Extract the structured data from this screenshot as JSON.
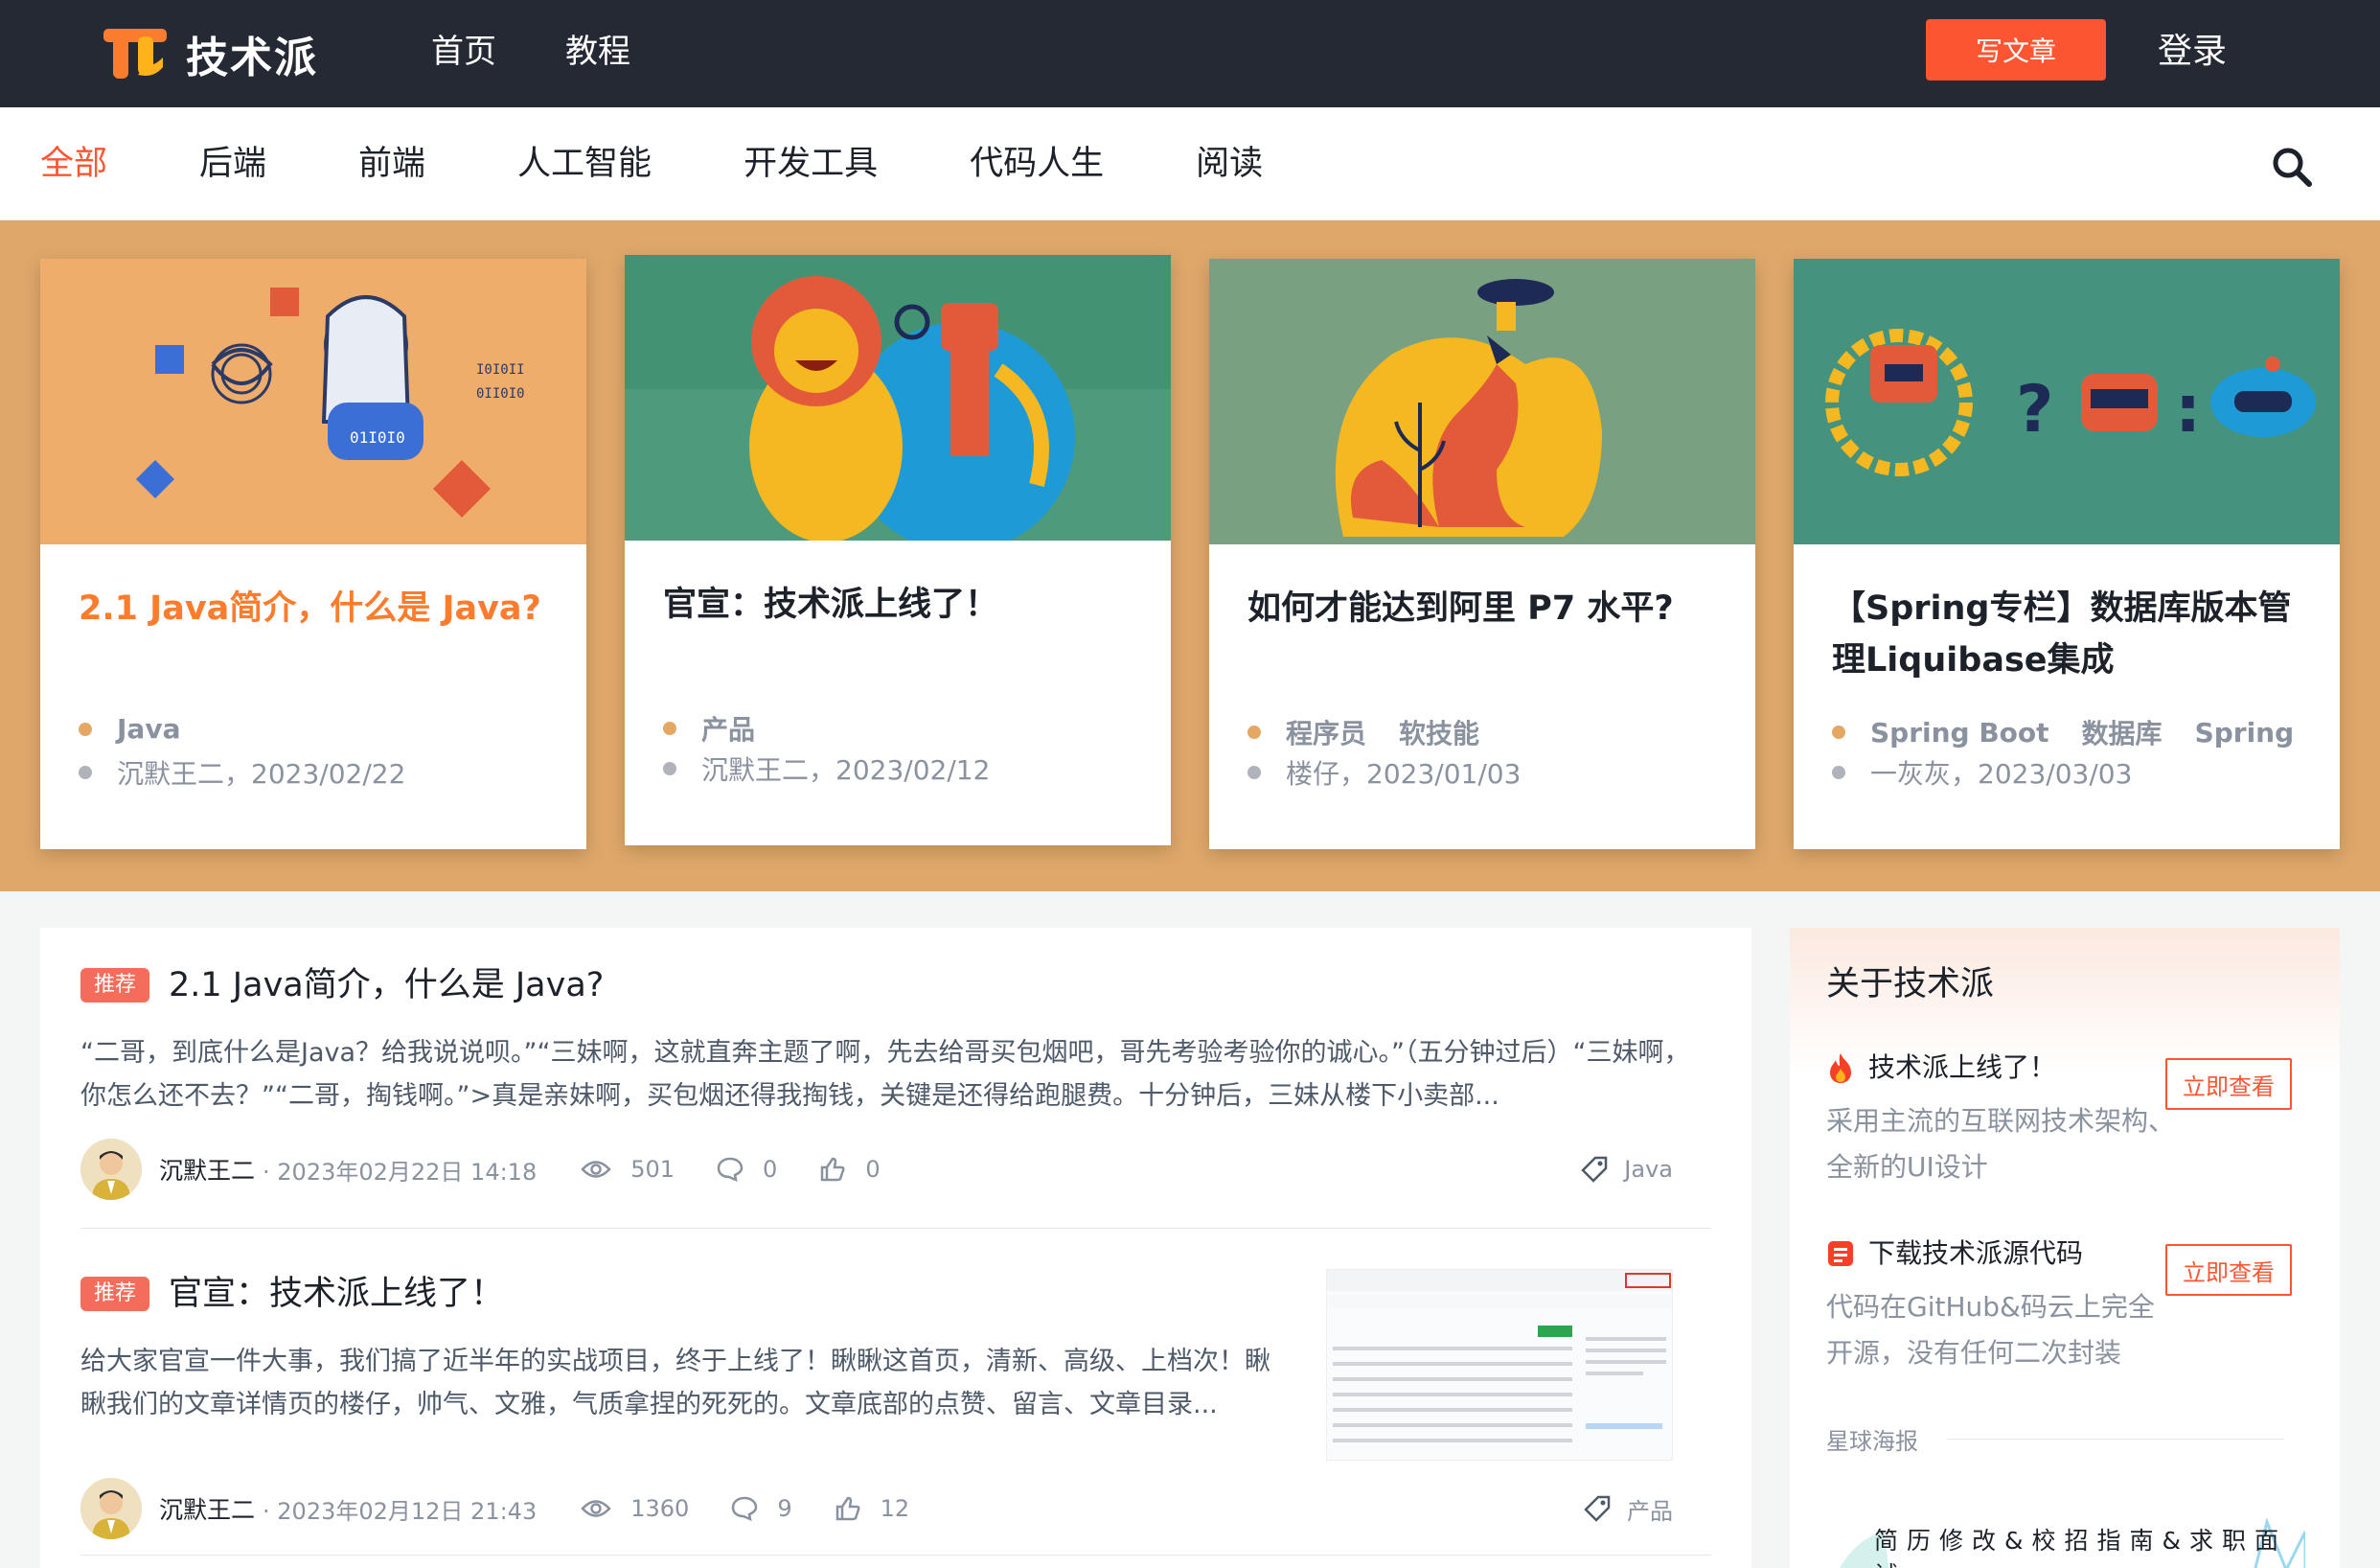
{
  "header": {
    "logo_text": "技术派",
    "nav": [
      "首页",
      "教程"
    ],
    "write_button": "写文章",
    "login": "登录"
  },
  "categories": {
    "items": [
      "全部",
      "后端",
      "前端",
      "人工智能",
      "开发工具",
      "代码人生",
      "阅读"
    ],
    "active": "全部"
  },
  "banner_cards": [
    {
      "title": "2.1 Java简介，什么是 Java?",
      "tags": [
        "Java"
      ],
      "author_date": "沉默王二，2023/02/22",
      "highlighted": true
    },
    {
      "title": "官宣：技术派上线了！",
      "tags": [
        "产品"
      ],
      "author_date": "沉默王二，2023/02/12",
      "highlighted": false
    },
    {
      "title": "如何才能达到阿里 P7 水平?",
      "tags": [
        "程序员",
        "软技能"
      ],
      "author_date": "楼仔，2023/01/03",
      "highlighted": false
    },
    {
      "title": "【Spring专栏】数据库版本管理Liquibase集成",
      "tags": [
        "Spring Boot",
        "数据库",
        "Spring"
      ],
      "author_date": "一灰灰，2023/03/03",
      "highlighted": false
    }
  ],
  "articles": [
    {
      "badge": "推荐",
      "title": "2.1 Java简介，什么是 Java?",
      "excerpt": "“二哥，到底什么是Java？给我说说呗。”“三妹啊，这就直奔主题了啊，先去给哥买包烟吧，哥先考验考验你的诚心。”（五分钟过后）“三妹啊，你怎么还不去？”“二哥，掏钱啊。”>真是亲妹啊，买包烟还得我掏钱，关键是还得给跑腿费。十分钟后，三妹从楼下小卖部...",
      "author": "沉默王二",
      "date": "· 2023年02月22日 14:18",
      "views": "501",
      "comments": "0",
      "likes": "0",
      "tag": "Java"
    },
    {
      "badge": "推荐",
      "title": "官宣：技术派上线了！",
      "excerpt": "给大家官宣一件大事，我们搞了近半年的实战项目，终于上线了！瞅瞅这首页，清新、高级、上档次！瞅瞅我们的文章详情页的楼仔，帅气、文雅，气质拿捏的死死的。文章底部的点赞、留言、文章目录...",
      "author": "沉默王二",
      "date": "· 2023年02月12日 21:43",
      "views": "1360",
      "comments": "9",
      "likes": "12",
      "tag": "产品"
    }
  ],
  "sidebar": {
    "title": "关于技术派",
    "items": [
      {
        "title": "技术派上线了！",
        "desc": "采用主流的互联网技术架构、全新的UI设计",
        "button": "立即查看"
      },
      {
        "title": "下载技术派源代码",
        "desc": "代码在GitHub&码云上完全开源，没有任何二次封装",
        "button": "立即查看"
      }
    ],
    "section_label": "星球海报",
    "poster_text": "简历修改&校招指南&求职面试"
  },
  "colors": {
    "accent": "#fc5531",
    "header_bg": "#252933",
    "banner_bg": "#dfa86a"
  }
}
